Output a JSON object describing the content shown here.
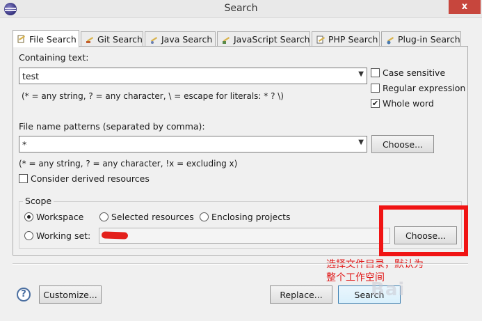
{
  "window": {
    "title": "Search",
    "close_glyph": "x"
  },
  "tabs": [
    {
      "label": "File Search",
      "icon": "file-search-icon",
      "active": true
    },
    {
      "label": "Git Search",
      "icon": "git-search-icon"
    },
    {
      "label": "Java Search",
      "icon": "java-search-icon"
    },
    {
      "label": "JavaScript Search",
      "icon": "javascript-search-icon"
    },
    {
      "label": "PHP Search",
      "icon": "php-search-icon"
    },
    {
      "label": "Plug-in Search",
      "icon": "plugin-search-icon"
    }
  ],
  "containing_text": {
    "label": "Containing text:",
    "value": "test",
    "hint": "(* = any string, ? = any character, \\ = escape for literals: * ? \\)"
  },
  "options": {
    "case_sensitive": {
      "label": "Case sensitive",
      "checked": false
    },
    "regular_expression": {
      "label": "Regular expression",
      "checked": false
    },
    "whole_word": {
      "label": "Whole word",
      "checked": true
    }
  },
  "file_patterns": {
    "label": "File name patterns (separated by comma):",
    "value": "*",
    "choose_label": "Choose...",
    "hint": "(* = any string, ? = any character, !x = excluding x)"
  },
  "derived": {
    "label": "Consider derived resources",
    "checked": false
  },
  "scope": {
    "legend": "Scope",
    "workspace": "Workspace",
    "selected_resources": "Selected resources",
    "enclosing_projects": "Enclosing projects",
    "working_set": "Working set:",
    "selected": "workspace",
    "choose_label": "Choose..."
  },
  "annotation": {
    "line1": "选择文件目录，默认为",
    "line2": "整个工作空间"
  },
  "footer": {
    "customize_label": "Customize...",
    "replace_label": "Replace...",
    "search_label": "Search"
  },
  "watermark": "Bai"
}
